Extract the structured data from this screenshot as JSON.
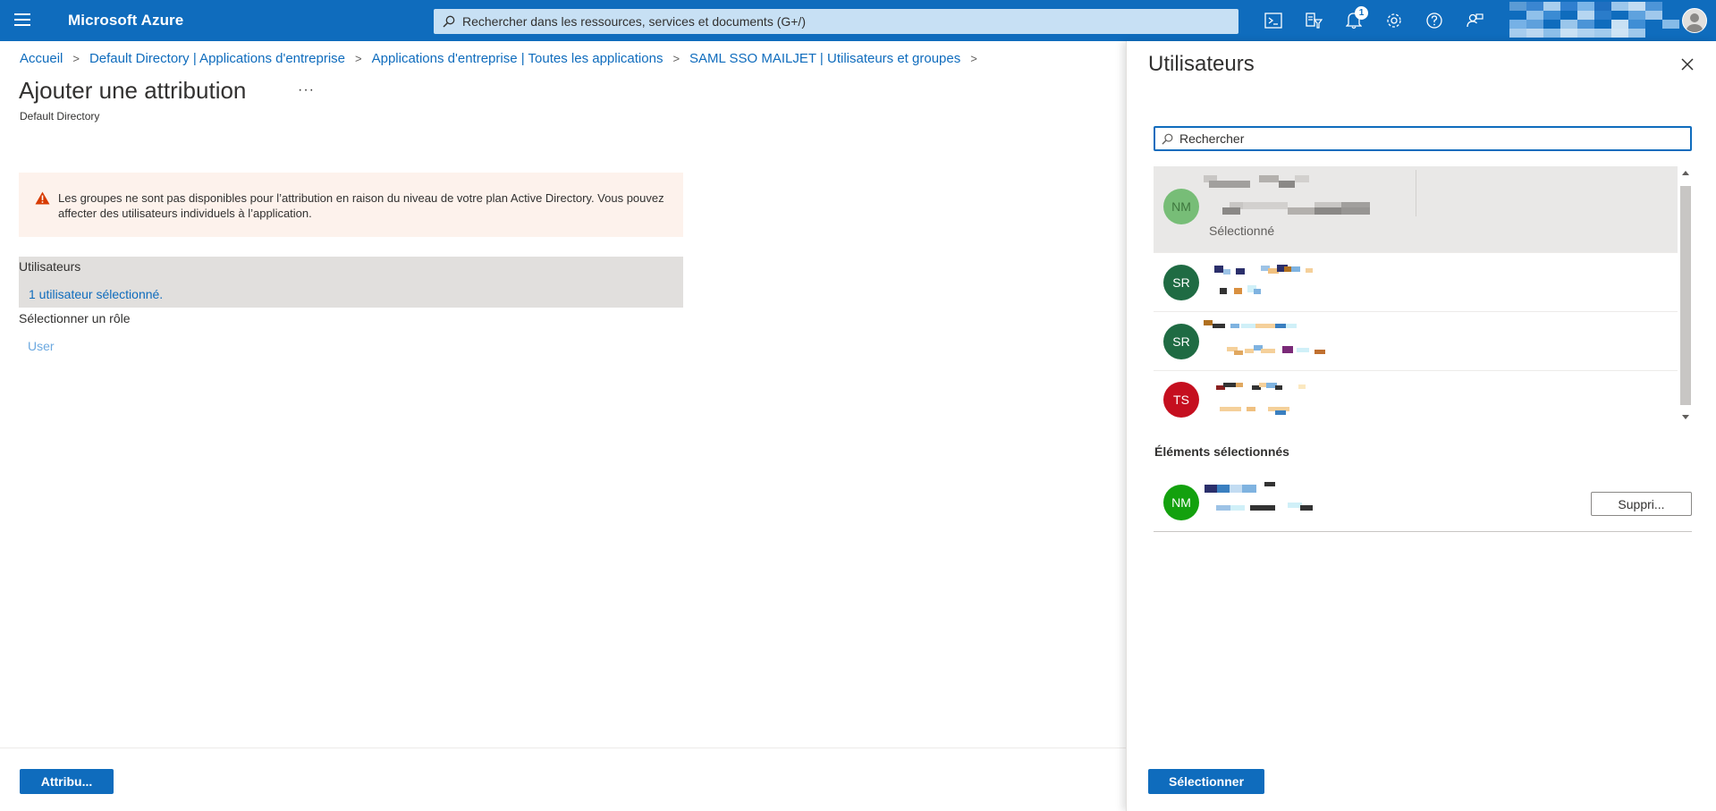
{
  "topbar": {
    "brand": "Microsoft Azure",
    "search_placeholder": "Rechercher dans les ressources, services et documents (G+/)",
    "notification_count": "1",
    "icons": [
      "cloud-shell-icon",
      "directory-filter-icon",
      "notifications-icon",
      "settings-icon",
      "help-icon",
      "feedback-icon"
    ],
    "accent_color": "#0f6cbd"
  },
  "breadcrumb": [
    "Accueil",
    "Default Directory | Applications d'entreprise",
    "Applications d'entreprise | Toutes les applications",
    "SAML SSO MAILJET | Utilisateurs et groupes"
  ],
  "page": {
    "title": "Ajouter une attribution",
    "more": "···",
    "subtitle": "Default Directory"
  },
  "warning": {
    "text": "Les groupes ne sont pas disponibles pour l’attribution en raison du niveau de votre plan Active Directory. Vous pouvez affecter des utilisateurs individuels à l’application.",
    "color": "#fdf2ec"
  },
  "assignment": {
    "users_label": "Utilisateurs",
    "users_value": "1 utilisateur sélectionné.",
    "role_label": "Sélectionner un rôle",
    "role_value": "User"
  },
  "footer": {
    "assign_button": "Attribu..."
  },
  "blade": {
    "title": "Utilisateurs",
    "search_placeholder": "Rechercher",
    "users": [
      {
        "initials": "NM",
        "color": "#6bb96b",
        "status": "Sélectionné",
        "selected": true
      },
      {
        "initials": "SR",
        "color": "#1f6b43",
        "status": "",
        "selected": false
      },
      {
        "initials": "SR",
        "color": "#1f6b43",
        "status": "",
        "selected": false
      },
      {
        "initials": "TS",
        "color": "#c50f1f",
        "status": "",
        "selected": false
      }
    ],
    "selected_heading": "Éléments sélectionnés",
    "selected_item": {
      "initials": "NM",
      "color": "#13a10e"
    },
    "remove_button": "Suppri...",
    "select_button": "Sélectionner"
  }
}
